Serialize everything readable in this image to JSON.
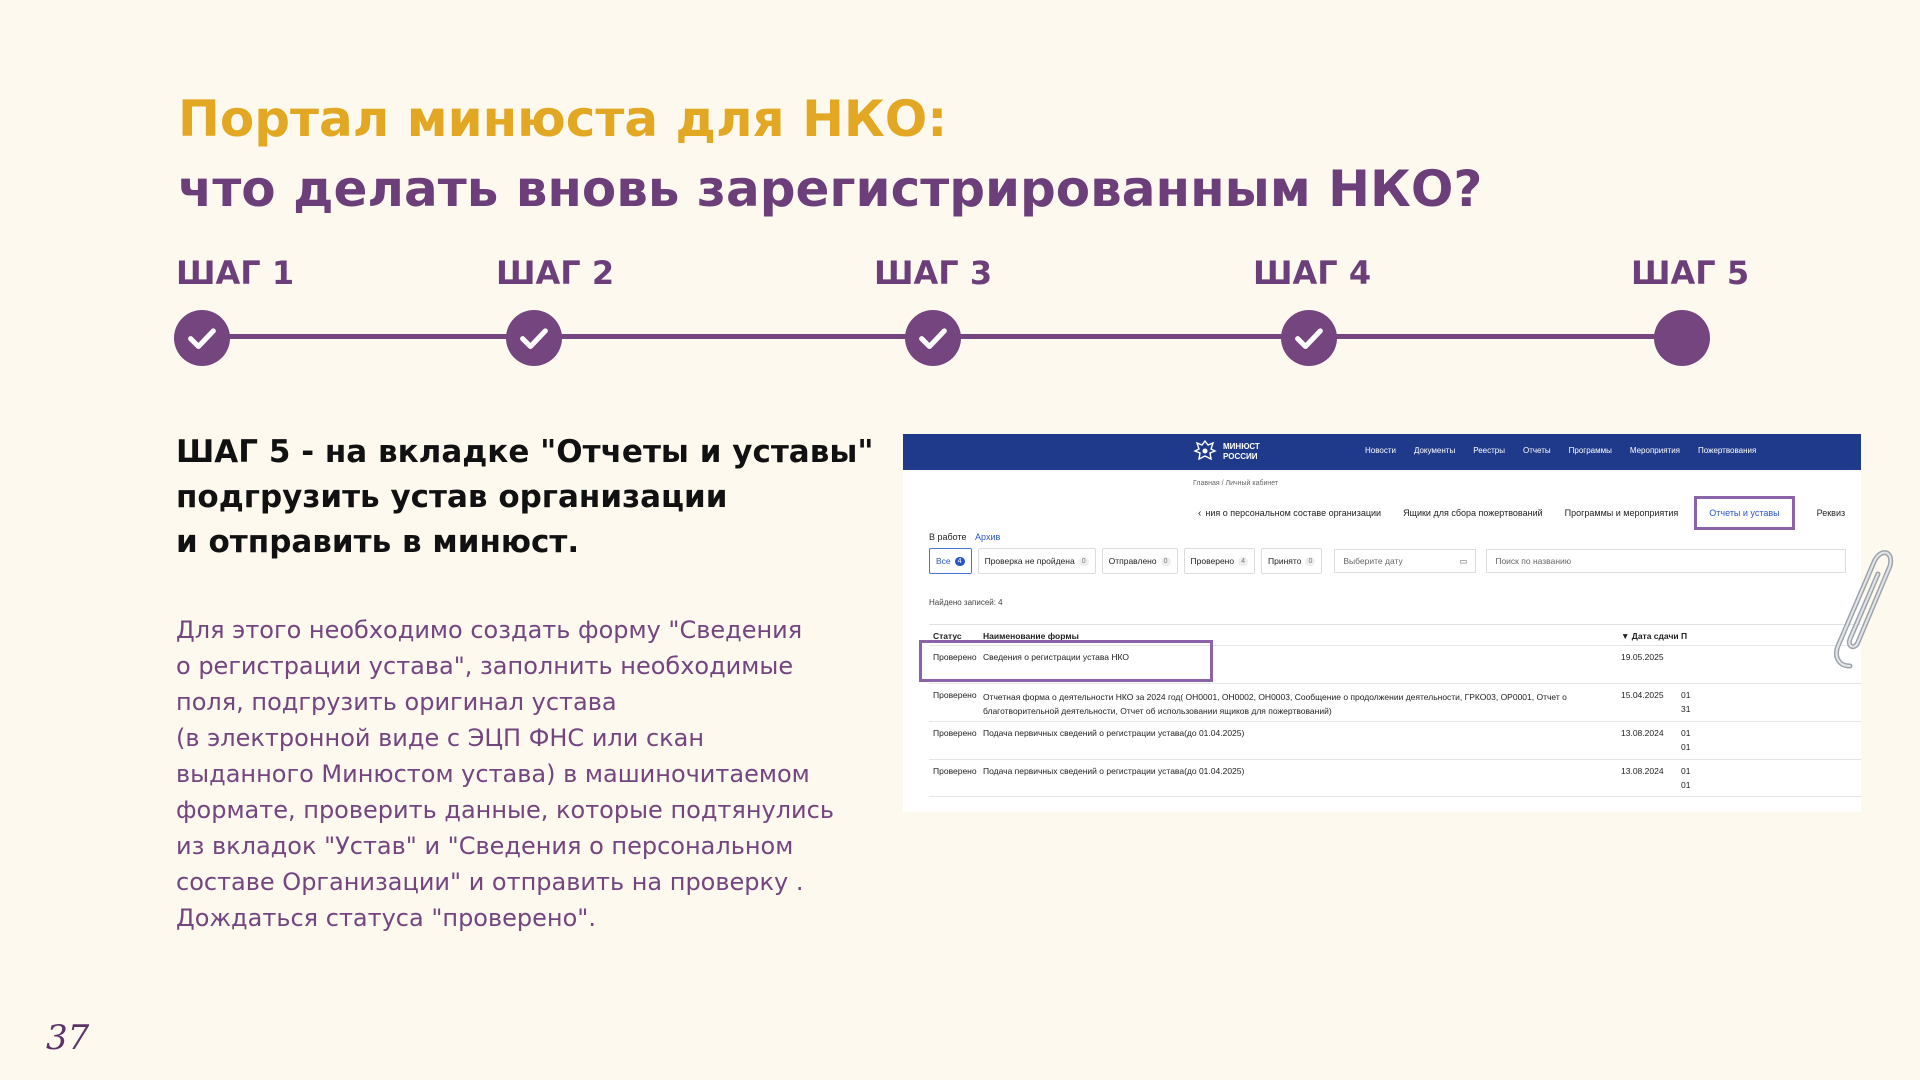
{
  "slide": {
    "title_line1": "Портал минюста для НКО:",
    "title_line2": "что делать вновь зарегистрированным НКО?",
    "page_number": "37"
  },
  "steps": [
    {
      "label": "ШАГ 1",
      "done": true
    },
    {
      "label": "ШАГ 2",
      "done": true
    },
    {
      "label": "ШАГ 3",
      "done": true
    },
    {
      "label": "ШАГ 4",
      "done": true
    },
    {
      "label": "ШАГ 5",
      "done": false
    }
  ],
  "heading": {
    "line1": "ШАГ 5 - на вкладке \"Отчеты и уставы\"",
    "line2": "подгрузить устав организации",
    "line3": "и отправить в минюст."
  },
  "description": {
    "line1": "Для этого необходимо создать форму \"Сведения",
    "line2": "о регистрации устава\", заполнить необходимые",
    "line3": "поля, подгрузить оригинал устава",
    "line4": "(в электронной виде с ЭЦП ФНС или скан",
    "line5": "выданного Минюстом устава) в машиночитаемом",
    "line6": "формате, проверить данные, которые подтянулись",
    "line7": "из вкладок \"Устав\" и \"Сведения о персональном",
    "line8": "составе Организации\" и отправить на проверку .",
    "line9": "Дождаться статуса \"проверено\"."
  },
  "portal": {
    "logo_line1": "МИНЮСТ",
    "logo_line2": "РОССИИ",
    "nav": [
      "Новости",
      "Документы",
      "Реестры",
      "Отчеты",
      "Программы",
      "Мероприятия",
      "Пожертвования"
    ],
    "breadcrumb": "Главная / Личный кабинет",
    "tabs": {
      "personnel": "ния о персональном составе организации",
      "donation_boxes": "Ящики для сбора пожертвований",
      "programs": "Программы и мероприятия",
      "reports": "Отчеты и уставы",
      "requisites": "Реквиз"
    },
    "work_label": "В работе",
    "archive_label": "Архив",
    "filters": [
      {
        "label": "Все",
        "count": "4"
      },
      {
        "label": "Проверка не пройдена",
        "count": "0"
      },
      {
        "label": "Отправлено",
        "count": "0"
      },
      {
        "label": "Проверено",
        "count": "4"
      },
      {
        "label": "Принято",
        "count": "0"
      }
    ],
    "date_placeholder": "Выберите дату",
    "search_placeholder": "Поиск по названию",
    "found_records": "Найдено записей: 4",
    "table": {
      "col_status": "Статус",
      "col_name": "Наименование формы",
      "col_date": "▼ Дата сдачи",
      "col_extra": "П",
      "rows": [
        {
          "status": "Проверено",
          "name": "Сведения о регистрации устава НКО",
          "date": "19.05.2025",
          "extra1": "",
          "extra2": ""
        },
        {
          "status": "Проверено",
          "name": "Отчетная форма о деятельности НКО за 2024 год( ОН0001, ОН0002, ОН0003, Сообщение о продолжении деятельности, ГРКО03, ОР0001, Отчет о благотворительной деятельности, Отчет об использовании ящиков для пожертвований)",
          "date": "15.04.2025",
          "extra1": "01",
          "extra2": "31"
        },
        {
          "status": "Проверено",
          "name": "Подача первичных сведений о регистрации устава(до 01.04.2025)",
          "date": "13.08.2024",
          "extra1": "01",
          "extra2": "01"
        },
        {
          "status": "Проверено",
          "name": "Подача первичных сведений о регистрации устава(до 01.04.2025)",
          "date": "13.08.2024",
          "extra1": "01",
          "extra2": "01"
        }
      ]
    }
  },
  "colors": {
    "background": "#fdf9ee",
    "accent_gold": "#e3a823",
    "accent_purple": "#6d3f7a",
    "portal_nav": "#1f3a8a"
  }
}
